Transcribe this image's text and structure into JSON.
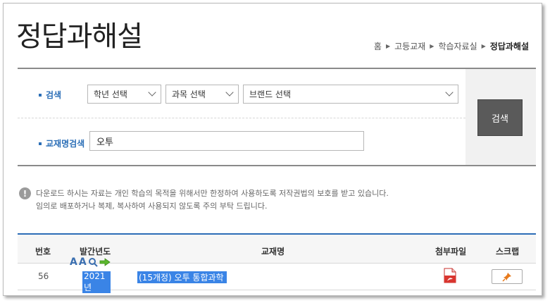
{
  "page": {
    "title": "정답과해설"
  },
  "breadcrumb": {
    "items": [
      "홈",
      "고등교재",
      "학습자료실"
    ],
    "current": "정답과해설"
  },
  "search": {
    "label": "검색",
    "grade_select": "학년 선택",
    "subject_select": "과목 선택",
    "brand_select": "브랜드 선택",
    "title_label": "교재명검색",
    "title_value": "오투",
    "button": "검색"
  },
  "notice": {
    "icon": "!",
    "line1": "다운로드 하시는 자료는 개인 학습의 목적을 위해서만 한정하여 사용하도록 저작권법의 보호를 받고 있습니다.",
    "line2": "임의로 배포하거나 복제, 복사하여 사용되지 않도록 주의 부탁 드립니다."
  },
  "table": {
    "headers": {
      "number": "번호",
      "year": "발간년도",
      "title": "교재명",
      "file": "첨부파일",
      "scrap": "스크랩"
    },
    "rows": [
      {
        "number": "56",
        "year": "2021년",
        "title": "(15개정) 오투 통합과학"
      }
    ]
  },
  "colors": {
    "accent": "#2d6db7",
    "highlight": "#3a84e6",
    "button_bg": "#5a5a5a"
  }
}
